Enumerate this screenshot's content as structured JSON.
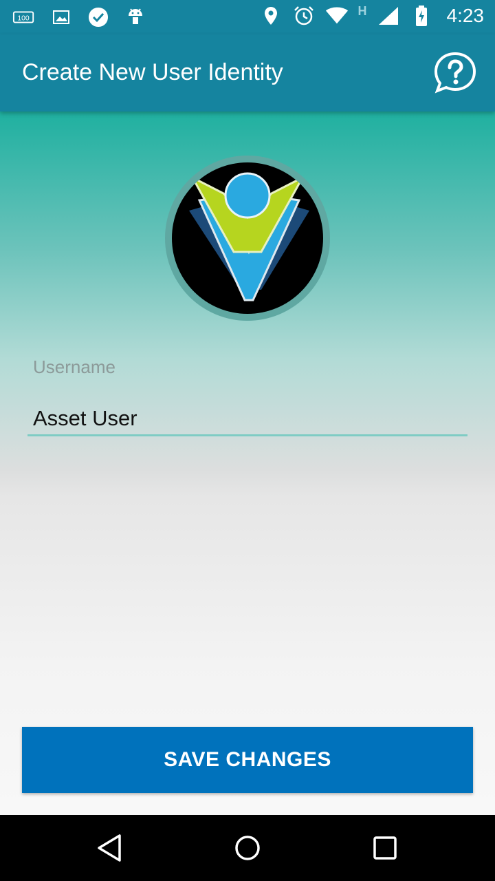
{
  "status_bar": {
    "time": "4:23",
    "network_type": "H",
    "left_icons": [
      "battery-100-icon",
      "image-icon",
      "check-badge-icon",
      "android-icon"
    ],
    "right_icons": [
      "location-icon",
      "alarm-icon",
      "wifi-icon",
      "signal-icon",
      "battery-charging-icon"
    ]
  },
  "app_bar": {
    "title": "Create New User Identity",
    "help_icon": "help-chat-icon"
  },
  "avatar": {
    "icon": "user-v-logo"
  },
  "form": {
    "username_label": "Username",
    "username_value": "Asset User"
  },
  "actions": {
    "save_label": "SAVE CHANGES"
  },
  "nav_bar": {
    "icons": [
      "back-icon",
      "home-icon",
      "recents-icon"
    ]
  },
  "colors": {
    "primary": "#15849f",
    "button": "#0072bc",
    "accent_line": "#7fccc4"
  }
}
